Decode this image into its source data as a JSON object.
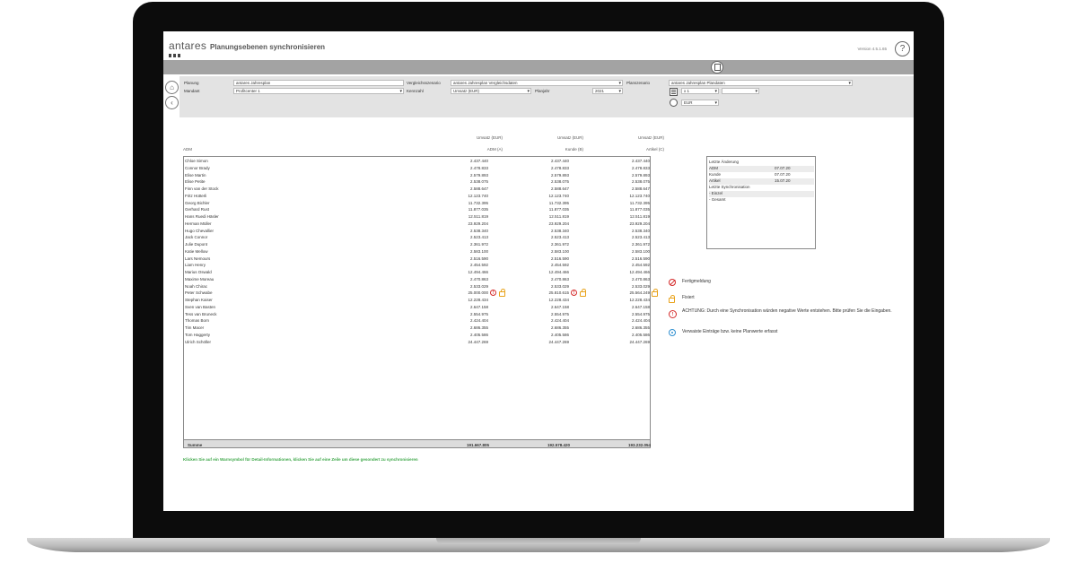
{
  "app": {
    "logo": "antares",
    "title": "Planungsebenen synchronisieren",
    "version": "Version 4.5.1.65",
    "help_label": "?"
  },
  "filters": {
    "planung_label": "Planung",
    "planung_value": "antares Jahresplan",
    "mandant_label": "Mandant",
    "mandant_value": "Profitcenter 1",
    "vergleich_label": "Vergleichsszenario",
    "vergleich_value": "antares Jahresplan Vergleichsdaten",
    "kennzahl_label": "Kennzahl",
    "kennzahl_value": "Umsatz (EUR)",
    "planjahr_label": "Planjahr",
    "planjahr_value": "2021",
    "planszenario_label": "Planszenario",
    "planszenario_value": "antares Jahresplan Plandaten",
    "faktor_value": "x 1",
    "faktor2_value": "",
    "waehrung_value": "EUR"
  },
  "table": {
    "row_header": "ADM",
    "columns": [
      {
        "metric": "Umsatz (EUR)",
        "label": "ADM (A)"
      },
      {
        "metric": "Umsatz (EUR)",
        "label": "Kunde (B)"
      },
      {
        "metric": "Umsatz (EUR)",
        "label": "Artikel (C)"
      }
    ],
    "rows": [
      {
        "name": "Chloe Simon",
        "a": "2.437.440",
        "b": "2.437.440",
        "c": "2.437.440"
      },
      {
        "name": "Connor Brady",
        "a": "2.478.833",
        "b": "2.478.833",
        "c": "2.478.833"
      },
      {
        "name": "Elise Martin",
        "a": "2.579.893",
        "b": "2.579.893",
        "c": "2.579.893"
      },
      {
        "name": "Elise Petite",
        "a": "2.538.075",
        "b": "2.538.075",
        "c": "2.538.075"
      },
      {
        "name": "Finn van der Stock",
        "a": "2.588.647",
        "b": "2.588.647",
        "c": "2.588.647"
      },
      {
        "name": "Fritz Hütterli",
        "a": "12.123.740",
        "b": "12.123.740",
        "c": "12.123.740"
      },
      {
        "name": "Georg Bichler",
        "a": "11.732.395",
        "b": "11.732.395",
        "c": "11.732.395"
      },
      {
        "name": "Gerhard Rust",
        "a": "11.877.035",
        "b": "11.877.035",
        "c": "11.877.035"
      },
      {
        "name": "Hans Ruedi Häsler",
        "a": "12.511.819",
        "b": "12.511.819",
        "c": "12.511.819"
      },
      {
        "name": "Herman Müller",
        "a": "23.929.204",
        "b": "23.929.204",
        "c": "23.929.204"
      },
      {
        "name": "Hugo Chevallier",
        "a": "2.538.340",
        "b": "2.538.340",
        "c": "2.538.340"
      },
      {
        "name": "Jack Connor",
        "a": "2.523.413",
        "b": "2.523.413",
        "c": "2.523.413"
      },
      {
        "name": "Julie Dupont",
        "a": "2.361.972",
        "b": "2.361.972",
        "c": "2.361.972"
      },
      {
        "name": "Katie Mellow",
        "a": "2.583.100",
        "b": "2.583.100",
        "c": "2.583.100"
      },
      {
        "name": "Lars Nemours",
        "a": "2.516.590",
        "b": "2.516.590",
        "c": "2.516.590"
      },
      {
        "name": "Liam Henry",
        "a": "2.454.592",
        "b": "2.454.592",
        "c": "2.454.592"
      },
      {
        "name": "Marius Oswald",
        "a": "12.494.466",
        "b": "12.494.466",
        "c": "12.494.466"
      },
      {
        "name": "Maxime Moreau",
        "a": "2.470.863",
        "b": "2.470.863",
        "c": "2.470.863"
      },
      {
        "name": "Noah Chirac",
        "a": "2.533.029",
        "b": "2.533.029",
        "c": "2.533.029"
      },
      {
        "name": "Peter Schwabe",
        "a": "25.000.000",
        "b": "25.810.615",
        "c": "25.564.249"
      },
      {
        "name": "Stephan Kaiser",
        "a": "12.228.434",
        "b": "12.228.434",
        "c": "12.228.434"
      },
      {
        "name": "Sven van Basten",
        "a": "2.647.158",
        "b": "2.647.158",
        "c": "2.647.158"
      },
      {
        "name": "Tess van Bruneck",
        "a": "2.554.975",
        "b": "2.554.975",
        "c": "2.554.975"
      },
      {
        "name": "Thomas Born",
        "a": "2.424.404",
        "b": "2.424.404",
        "c": "2.424.404"
      },
      {
        "name": "Tim Macer",
        "a": "2.686.355",
        "b": "2.686.355",
        "c": "2.686.355"
      },
      {
        "name": "Tom Haggerty",
        "a": "2.405.586",
        "b": "2.405.586",
        "c": "2.405.586"
      },
      {
        "name": "Ulrich Schöller",
        "a": "24.447.269",
        "b": "24.447.269",
        "c": "24.447.269"
      }
    ],
    "sum": {
      "name": "Summe",
      "a": "191.667.805",
      "b": "192.578.420",
      "c": "193.232.054"
    }
  },
  "hint": "Klicken Sie auf ein Warnsymbol für Detail-Informationen, klicken Sie auf eine Zeile um diese gesondert zu synchronisieren",
  "info_box": {
    "title": "Letzte Änderung",
    "rows": [
      {
        "label": "ADM",
        "value": "07.07.20"
      },
      {
        "label": "Kunde",
        "value": "07.07.20"
      },
      {
        "label": "Artikel",
        "value": "15.07.20"
      }
    ],
    "sync_title": "Letzte Synchronisation",
    "sync_rows": [
      "- Einzel",
      "- Gesamt"
    ]
  },
  "legend": {
    "fertig": "Fertigmeldung",
    "fixiert": "Fixiert",
    "achtung": "ACHTUNG: Durch eine Synchronisation würden negative Werte entstehen. Bitte prüfen Sie die Eingaben.",
    "verwaist": "Verwaiste Einträge bzw. keine Planwerte erfasst"
  },
  "colors": {
    "warning": "#d42a2a",
    "lock": "#e8a21a",
    "hint": "#3fa84a",
    "info": "#2f8fd0",
    "toolbar": "#a3a3a3",
    "filter_panel": "#e3e3e3"
  }
}
